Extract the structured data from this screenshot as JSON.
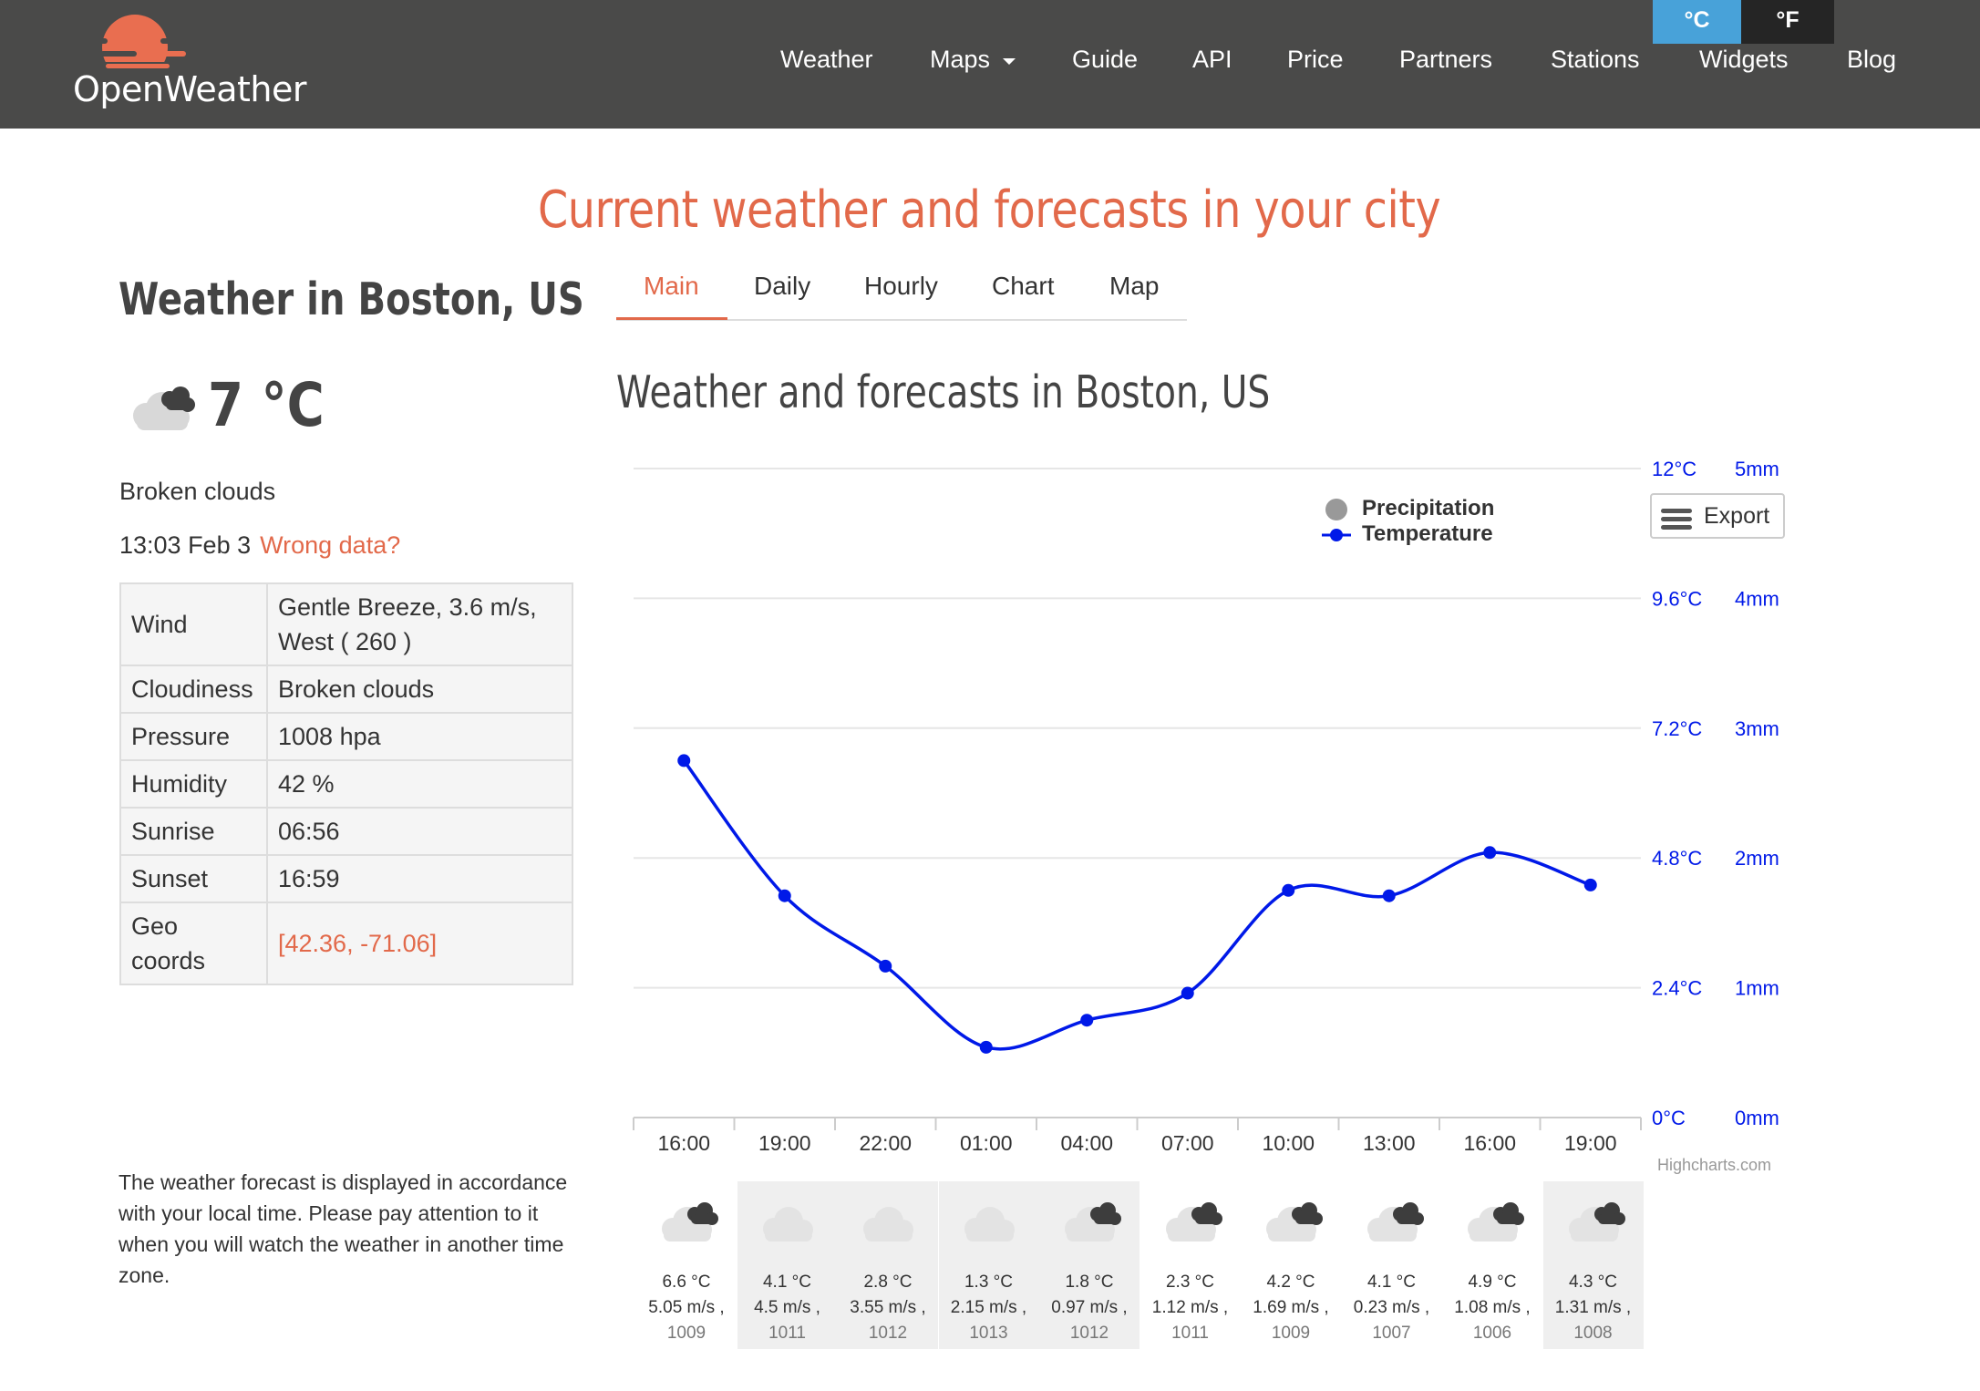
{
  "brand": {
    "name": "OpenWeather"
  },
  "units": {
    "celsius": "°C",
    "fahrenheit": "°F"
  },
  "nav": [
    {
      "label": "Weather"
    },
    {
      "label": "Maps"
    },
    {
      "label": "Guide"
    },
    {
      "label": "API"
    },
    {
      "label": "Price"
    },
    {
      "label": "Partners"
    },
    {
      "label": "Stations"
    },
    {
      "label": "Widgets"
    },
    {
      "label": "Blog"
    }
  ],
  "page_title": "Current weather and forecasts in your city",
  "current": {
    "city_title": "Weather in Boston, US",
    "temperature": "7 °C",
    "description": "Broken clouds",
    "time": "13:03 Feb 3",
    "wrong_data": "Wrong data?",
    "icon": "broken-clouds-icon",
    "details": [
      {
        "label": "Wind",
        "value": "Gentle Breeze, 3.6 m/s, West ( 260 )"
      },
      {
        "label": "Cloudiness",
        "value": "Broken clouds"
      },
      {
        "label": "Pressure",
        "value": "1008 hpa"
      },
      {
        "label": "Humidity",
        "value": "42 %"
      },
      {
        "label": "Sunrise",
        "value": "06:56"
      },
      {
        "label": "Sunset",
        "value": "16:59"
      },
      {
        "label": "Geo coords",
        "value": "[42.36, -71.06]"
      }
    ]
  },
  "note": "The weather forecast is displayed in accordance with your local time. Please pay attention to it when you will watch the weather in another time zone.",
  "tabs": [
    {
      "label": "Main"
    },
    {
      "label": "Daily"
    },
    {
      "label": "Hourly"
    },
    {
      "label": "Chart"
    },
    {
      "label": "Map"
    }
  ],
  "section_title": "Weather and forecasts in Boston, US",
  "export_label": "Export",
  "credits": "Highcharts.com",
  "colors": {
    "accent": "#e2694a",
    "temperature_line": "#0019e8",
    "precipitation": "#999999",
    "header": "#4a4a49",
    "unit_active": "#48a2d9"
  },
  "chart_data": {
    "type": "line",
    "categories": [
      "16:00",
      "19:00",
      "22:00",
      "01:00",
      "04:00",
      "07:00",
      "10:00",
      "13:00",
      "16:00",
      "19:00"
    ],
    "series": [
      {
        "name": "Precipitation",
        "values": [
          0,
          0,
          0,
          0,
          0,
          0,
          0,
          0,
          0,
          0
        ]
      },
      {
        "name": "Temperature",
        "values": [
          6.6,
          4.1,
          2.8,
          1.3,
          1.8,
          2.3,
          4.2,
          4.1,
          4.9,
          4.3
        ]
      }
    ],
    "y_temperature": {
      "ticks": [
        "12°C",
        "9.6°C",
        "7.2°C",
        "4.8°C",
        "2.4°C",
        "0°C"
      ],
      "range": [
        0,
        12
      ]
    },
    "y_precipitation": {
      "ticks": [
        "5mm",
        "4mm",
        "3mm",
        "2mm",
        "1mm",
        "0mm"
      ],
      "range": [
        0,
        5
      ]
    },
    "legend_position": "top-right",
    "grid": true
  },
  "forecast": [
    {
      "time": "16:00",
      "temp": "6.6 °C",
      "wind": "5.05 m/s ,",
      "pressure": "1009",
      "icon": "broken-clouds-icon",
      "shaded": false
    },
    {
      "time": "19:00",
      "temp": "4.1 °C",
      "wind": "4.5 m/s ,",
      "pressure": "1011",
      "icon": "cloud-icon",
      "shaded": true
    },
    {
      "time": "22:00",
      "temp": "2.8 °C",
      "wind": "3.55 m/s ,",
      "pressure": "1012",
      "icon": "cloud-icon",
      "shaded": true
    },
    {
      "time": "01:00",
      "temp": "1.3 °C",
      "wind": "2.15 m/s ,",
      "pressure": "1013",
      "icon": "cloud-icon",
      "shaded": true
    },
    {
      "time": "04:00",
      "temp": "1.8 °C",
      "wind": "0.97 m/s ,",
      "pressure": "1012",
      "icon": "broken-clouds-icon",
      "shaded": true
    },
    {
      "time": "07:00",
      "temp": "2.3 °C",
      "wind": "1.12 m/s ,",
      "pressure": "1011",
      "icon": "broken-clouds-icon",
      "shaded": false
    },
    {
      "time": "10:00",
      "temp": "4.2 °C",
      "wind": "1.69 m/s ,",
      "pressure": "1009",
      "icon": "broken-clouds-icon",
      "shaded": false
    },
    {
      "time": "13:00",
      "temp": "4.1 °C",
      "wind": "0.23 m/s ,",
      "pressure": "1007",
      "icon": "broken-clouds-icon",
      "shaded": false
    },
    {
      "time": "16:00",
      "temp": "4.9 °C",
      "wind": "1.08 m/s ,",
      "pressure": "1006",
      "icon": "broken-clouds-icon",
      "shaded": false
    },
    {
      "time": "19:00",
      "temp": "4.3 °C",
      "wind": "1.31 m/s ,",
      "pressure": "1008",
      "icon": "broken-clouds-icon",
      "shaded": true
    }
  ]
}
